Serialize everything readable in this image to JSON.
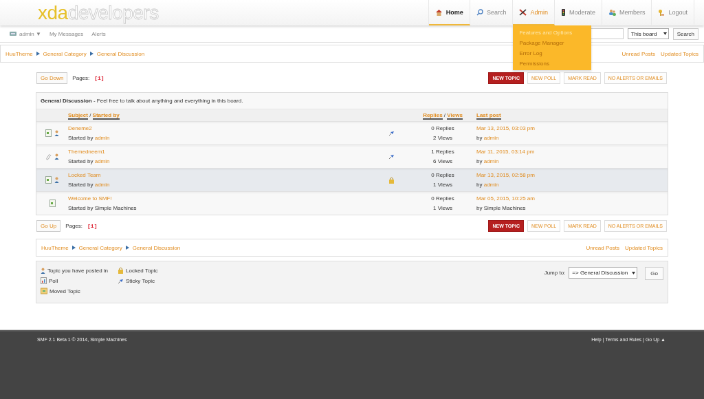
{
  "logo": {
    "primary": "xda",
    "secondary": "developers"
  },
  "nav": [
    {
      "label": "Home",
      "kind": "house",
      "selected": true,
      "expanded": false
    },
    {
      "label": "Search",
      "kind": "search",
      "selected": false,
      "expanded": false
    },
    {
      "label": "Admin",
      "kind": "tools",
      "selected": false,
      "expanded": true,
      "menu": [
        {
          "label": "Features and Options",
          "selected": true
        },
        {
          "label": "Package Manager",
          "selected": false
        },
        {
          "label": "Error Log",
          "selected": false
        },
        {
          "label": "Permissions",
          "selected": false
        }
      ]
    },
    {
      "label": "Moderate",
      "kind": "signal",
      "selected": false,
      "expanded": false
    },
    {
      "label": "Members",
      "kind": "people",
      "selected": false,
      "expanded": false
    },
    {
      "label": "Logout",
      "kind": "key",
      "selected": false,
      "expanded": false
    }
  ],
  "user_bar": {
    "user": "admin ▼",
    "links": [
      "My Messages",
      "Alerts"
    ],
    "search_scope": "This board",
    "search_button": "Search"
  },
  "breadcrumb_top": {
    "items": [
      "HuuTheme",
      "General Category",
      "General Discussion"
    ],
    "links": [
      "Unread Posts",
      "Updated Topics"
    ]
  },
  "pager_top": {
    "button": "Go Down",
    "label": "Pages:",
    "pages": "[1]"
  },
  "buttons_top": [
    {
      "label": "NEW TOPIC",
      "primary": true
    },
    {
      "label": "NEW POLL",
      "primary": false
    },
    {
      "label": "MARK READ",
      "primary": false
    },
    {
      "label": "NO ALERTS OR EMAILS",
      "primary": false
    }
  ],
  "board": {
    "title": "General Discussion",
    "description": " - Feel free to talk about anything and everything in this board.",
    "columns": {
      "subject": "Subject",
      "started_by": "Started by",
      "sep": "/",
      "replies": "Replies",
      "views": "Views",
      "last_post": "Last post"
    },
    "topics": [
      {
        "kind": "document-sticky",
        "posted_in": true,
        "title": "Deneme2",
        "started_prefix": "Started by",
        "starter": "admin",
        "starter_member": true,
        "replies": "0 Replies",
        "views": "2 Views",
        "last_date": "Mar 13, 2015, 03:03 pm",
        "last_prefix": "by",
        "last_author": "admin",
        "last_member": true
      },
      {
        "kind": "attachment-sticky",
        "posted_in": true,
        "title": "Themedneem1",
        "started_prefix": "Started by",
        "starter": "admin",
        "starter_member": true,
        "replies": "1 Replies",
        "views": "6 Views",
        "last_date": "Mar 11, 2015, 03:14 pm",
        "last_prefix": "by",
        "last_author": "admin",
        "last_member": true
      },
      {
        "kind": "document-locked",
        "posted_in": true,
        "title": "Locked Team",
        "started_prefix": "Started by",
        "starter": "admin",
        "starter_member": true,
        "replies": "0 Replies",
        "views": "1 Views",
        "last_date": "Mar 13, 2015, 02:58 pm",
        "last_prefix": "by",
        "last_author": "admin",
        "last_member": true
      },
      {
        "kind": "document",
        "posted_in": false,
        "title": "Welcome to SMF!",
        "started_prefix": "Started by",
        "starter": "Simple Machines",
        "starter_member": false,
        "replies": "0 Replies",
        "views": "1 Views",
        "last_date": "Mar 05, 2015, 10:25 am",
        "last_prefix": "by",
        "last_author": "Simple Machines",
        "last_member": false
      }
    ]
  },
  "pager_bottom": {
    "button": "Go Up",
    "label": "Pages:",
    "pages": "[1]"
  },
  "buttons_bottom": [
    {
      "label": "NEW TOPIC",
      "primary": true
    },
    {
      "label": "NEW POLL",
      "primary": false
    },
    {
      "label": "MARK READ",
      "primary": false
    },
    {
      "label": "NO ALERTS OR EMAILS",
      "primary": false
    }
  ],
  "breadcrumb_bottom": {
    "items": [
      "HuuTheme",
      "General Category",
      "General Discussion"
    ],
    "links": [
      "Unread Posts",
      "Updated Topics"
    ]
  },
  "legend": [
    {
      "kind": "posted",
      "label": "Topic you have posted in"
    },
    {
      "kind": "locked",
      "label": "Locked Topic"
    },
    {
      "kind": "poll",
      "label": "Poll"
    },
    {
      "kind": "sticky",
      "label": "Sticky Topic"
    },
    {
      "kind": "moved",
      "label": "Moved Topic"
    }
  ],
  "jump": {
    "label": "Jump to:",
    "value": "=> General Discussion",
    "button": "Go"
  },
  "footer": {
    "left": "SMF 2.1 Beta 1 © 2014, Simple Machines",
    "links": [
      "Help",
      "Terms and Rules",
      "Go Up ▲"
    ],
    "separator": "|"
  }
}
